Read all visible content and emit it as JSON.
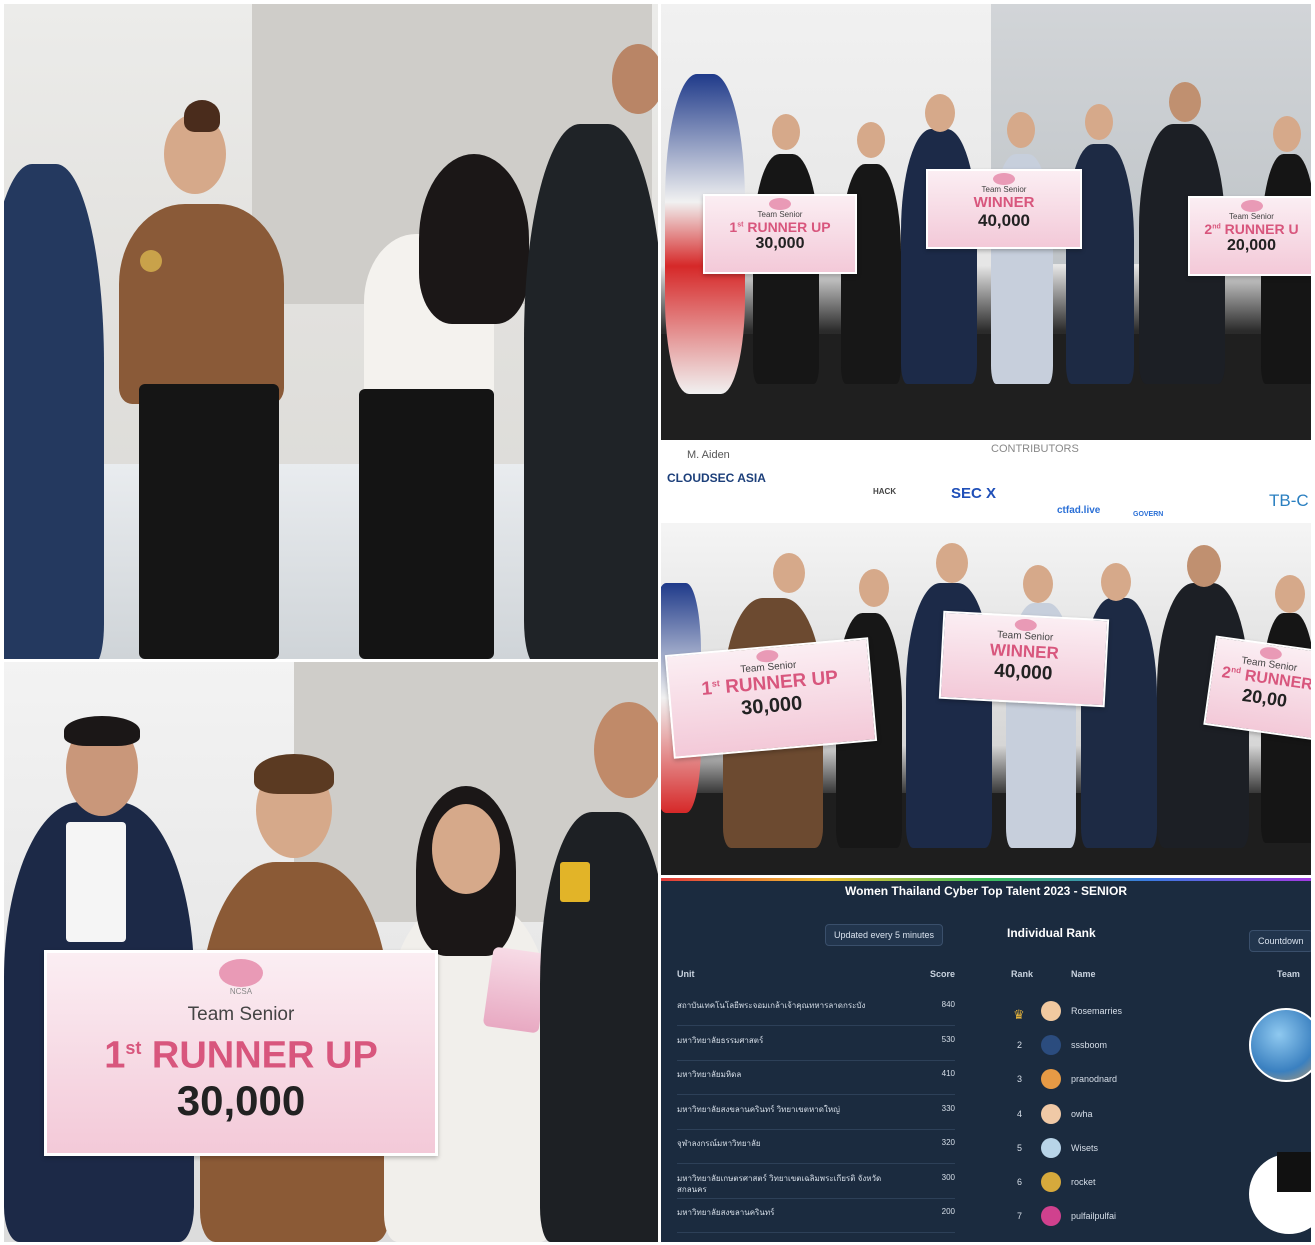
{
  "panel_top_right": {
    "board_left": {
      "team": "Team Senior",
      "title_num": "1",
      "title_sup": "st",
      "title_rest": "RUNNER UP",
      "amount": "30,000"
    },
    "board_center": {
      "team": "Team Senior",
      "title": "WINNER",
      "amount": "40,000"
    },
    "board_right": {
      "team": "Team Senior",
      "title_num": "2",
      "title_sup": "nd",
      "title_rest": "RUNNER U",
      "amount": "20,000"
    }
  },
  "panel_mid_right": {
    "sponsors": {
      "cloudsec": "CLOUDSEC ASIA",
      "m_aiden": "M. Aiden",
      "hack": "HACK",
      "secx": "SEC X",
      "ctfad": "ctfad.live",
      "govern": "GOVERN",
      "tb": "TB-C",
      "contributors": "CONTRIBUTORS"
    },
    "board_left": {
      "team": "Team Senior",
      "title_num": "1",
      "title_sup": "st",
      "title_rest": "RUNNER UP",
      "amount": "30,000"
    },
    "board_center": {
      "team": "Team Senior",
      "title": "WINNER",
      "amount": "40,000"
    },
    "board_right": {
      "team": "Team Senior",
      "title_num": "2",
      "title_sup": "nd",
      "title_rest": "RUNNER",
      "amount": "20,00"
    }
  },
  "panel_bottom_left": {
    "board": {
      "team": "Team Senior",
      "title_num": "1",
      "title_sup": "st",
      "title_rest": "RUNNER UP",
      "amount": "30,000"
    },
    "brand_ncsa": "NCSA"
  },
  "leaderboard": {
    "title": "Women Thailand Cyber Top Talent 2023 - SENIOR",
    "updated": "Updated every 5 minutes",
    "col_unit": "Unit",
    "col_score": "Score",
    "units": [
      {
        "unit": "สถาบันเทคโนโลยีพระจอมเกล้าเจ้าคุณทหารลาดกระบัง",
        "score": "840"
      },
      {
        "unit": "มหาวิทยาลัยธรรมศาสตร์",
        "score": "530"
      },
      {
        "unit": "มหาวิทยาลัยมหิดล",
        "score": "410"
      },
      {
        "unit": "มหาวิทยาลัยสงขลานครินทร์ วิทยาเขตหาดใหญ่",
        "score": "330"
      },
      {
        "unit": "จุฬาลงกรณ์มหาวิทยาลัย",
        "score": "320"
      },
      {
        "unit": "มหาวิทยาลัยเกษตรศาสตร์ วิทยาเขตเฉลิมพระเกียรติ จังหวัดสกลนคร",
        "score": "300"
      },
      {
        "unit": "มหาวิทยาลัยสงขลานครินทร์",
        "score": "200"
      }
    ],
    "individual_title": "Individual Rank",
    "countdown": "Countdown",
    "col_rank": "Rank",
    "col_name": "Name",
    "col_team": "Team",
    "individuals": [
      {
        "rank": "",
        "name": "Rosemarries"
      },
      {
        "rank": "2",
        "name": "sssboom"
      },
      {
        "rank": "3",
        "name": "pranodnard"
      },
      {
        "rank": "4",
        "name": "owha"
      },
      {
        "rank": "5",
        "name": "Wisets"
      },
      {
        "rank": "6",
        "name": "rocket"
      },
      {
        "rank": "7",
        "name": "pulfailpulfai"
      }
    ]
  }
}
